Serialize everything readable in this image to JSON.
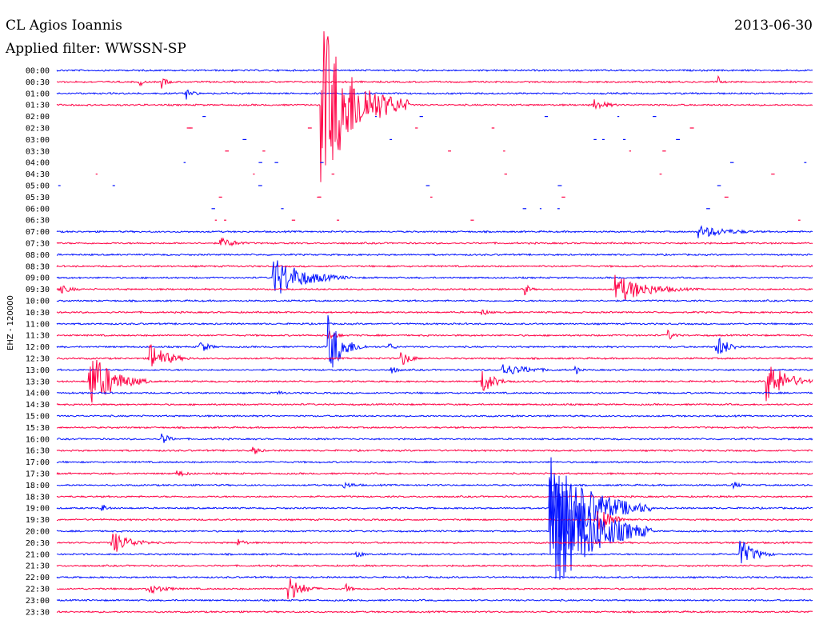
{
  "header": {
    "station": "CL Agios Ioannis",
    "date": "2013-06-30",
    "filter": "Applied filter: WWSSN-SP"
  },
  "channel_label": "EHZ - 120000",
  "colors": {
    "odd": "#ff0044",
    "even": "#0010ff"
  },
  "chart_data": {
    "type": "line",
    "xlabel": "",
    "ylabel": "EHZ - 120000",
    "grid": false,
    "rows": [
      "00:00",
      "00:30",
      "01:00",
      "01:30",
      "02:00",
      "02:30",
      "03:00",
      "03:30",
      "04:00",
      "04:30",
      "05:00",
      "05:30",
      "06:00",
      "06:30",
      "07:00",
      "07:30",
      "08:00",
      "08:30",
      "09:00",
      "09:30",
      "10:00",
      "10:30",
      "11:00",
      "11:30",
      "12:00",
      "12:30",
      "13:00",
      "13:30",
      "14:00",
      "14:30",
      "15:00",
      "15:30",
      "16:00",
      "16:30",
      "17:00",
      "17:30",
      "18:00",
      "18:30",
      "19:00",
      "19:30",
      "20:00",
      "20:30",
      "21:00",
      "21:30",
      "22:00",
      "22:30",
      "23:00",
      "23:30"
    ],
    "row_minutes": 30,
    "events": [
      {
        "row": "00:30",
        "minute": 3.3,
        "amp": 6,
        "dur": 0.5
      },
      {
        "row": "00:30",
        "minute": 4.2,
        "amp": 7,
        "dur": 0.6
      },
      {
        "row": "00:30",
        "minute": 26.3,
        "amp": 5,
        "dur": 0.3
      },
      {
        "row": "01:00",
        "minute": 5.1,
        "amp": 9,
        "dur": 0.8
      },
      {
        "row": "01:30",
        "minute": 10.5,
        "amp": 110,
        "dur": 3.5
      },
      {
        "row": "01:30",
        "minute": 11.2,
        "amp": 12,
        "dur": 1.8
      },
      {
        "row": "01:30",
        "minute": 21.3,
        "amp": 8,
        "dur": 1.5
      },
      {
        "row": "07:00",
        "minute": 25.5,
        "amp": 8,
        "dur": 3.5
      },
      {
        "row": "07:30",
        "minute": 6.5,
        "amp": 7,
        "dur": 1.8
      },
      {
        "row": "09:00",
        "minute": 8.6,
        "amp": 27,
        "dur": 3.2
      },
      {
        "row": "09:30",
        "minute": 0.1,
        "amp": 6,
        "dur": 1.5
      },
      {
        "row": "09:30",
        "minute": 18.6,
        "amp": 7,
        "dur": 0.6
      },
      {
        "row": "09:30",
        "minute": 22.2,
        "amp": 18,
        "dur": 3.5
      },
      {
        "row": "10:30",
        "minute": 16.9,
        "amp": 4,
        "dur": 1.0
      },
      {
        "row": "11:30",
        "minute": 10.8,
        "amp": 7,
        "dur": 1.0
      },
      {
        "row": "11:30",
        "minute": 24.3,
        "amp": 6,
        "dur": 0.8
      },
      {
        "row": "12:00",
        "minute": 5.7,
        "amp": 8,
        "dur": 1.0
      },
      {
        "row": "12:00",
        "minute": 10.8,
        "amp": 38,
        "dur": 1.5
      },
      {
        "row": "12:00",
        "minute": 13.2,
        "amp": 5,
        "dur": 0.8
      },
      {
        "row": "12:00",
        "minute": 26.2,
        "amp": 16,
        "dur": 1.2
      },
      {
        "row": "12:30",
        "minute": 3.7,
        "amp": 20,
        "dur": 1.8
      },
      {
        "row": "12:30",
        "minute": 13.7,
        "amp": 10,
        "dur": 1.0
      },
      {
        "row": "13:00",
        "minute": 13.3,
        "amp": 5,
        "dur": 0.8
      },
      {
        "row": "13:00",
        "minute": 17.7,
        "amp": 8,
        "dur": 3.2
      },
      {
        "row": "13:00",
        "minute": 20.6,
        "amp": 6,
        "dur": 0.5
      },
      {
        "row": "13:30",
        "minute": 1.3,
        "amp": 40,
        "dur": 2.4
      },
      {
        "row": "13:30",
        "minute": 16.9,
        "amp": 15,
        "dur": 1.4
      },
      {
        "row": "13:30",
        "minute": 28.2,
        "amp": 26,
        "dur": 2.2
      },
      {
        "row": "14:00",
        "minute": 8.8,
        "amp": 3,
        "dur": 1.0
      },
      {
        "row": "16:00",
        "minute": 4.2,
        "amp": 8,
        "dur": 0.8
      },
      {
        "row": "16:30",
        "minute": 7.8,
        "amp": 6,
        "dur": 0.8
      },
      {
        "row": "17:30",
        "minute": 4.8,
        "amp": 4,
        "dur": 1.5
      },
      {
        "row": "18:00",
        "minute": 11.4,
        "amp": 4,
        "dur": 1.8
      },
      {
        "row": "18:00",
        "minute": 26.8,
        "amp": 6,
        "dur": 0.8
      },
      {
        "row": "19:00",
        "minute": 1.8,
        "amp": 6,
        "dur": 0.6
      },
      {
        "row": "19:00",
        "minute": 19.6,
        "amp": 75,
        "dur": 4.0
      },
      {
        "row": "19:00",
        "minute": 23.2,
        "amp": 5,
        "dur": 0.5
      },
      {
        "row": "19:30",
        "minute": 21.5,
        "amp": 18,
        "dur": 1.5
      },
      {
        "row": "20:00",
        "minute": 19.6,
        "amp": 95,
        "dur": 4.0
      },
      {
        "row": "20:30",
        "minute": 2.2,
        "amp": 15,
        "dur": 2.0
      },
      {
        "row": "20:30",
        "minute": 7.2,
        "amp": 5,
        "dur": 1.0
      },
      {
        "row": "21:00",
        "minute": 11.9,
        "amp": 5,
        "dur": 0.8
      },
      {
        "row": "21:00",
        "minute": 27.1,
        "amp": 21,
        "dur": 1.5
      },
      {
        "row": "22:30",
        "minute": 3.6,
        "amp": 7,
        "dur": 2.0
      },
      {
        "row": "22:30",
        "minute": 9.2,
        "amp": 18,
        "dur": 1.4
      },
      {
        "row": "22:30",
        "minute": 11.5,
        "amp": 6,
        "dur": 0.6
      }
    ]
  }
}
